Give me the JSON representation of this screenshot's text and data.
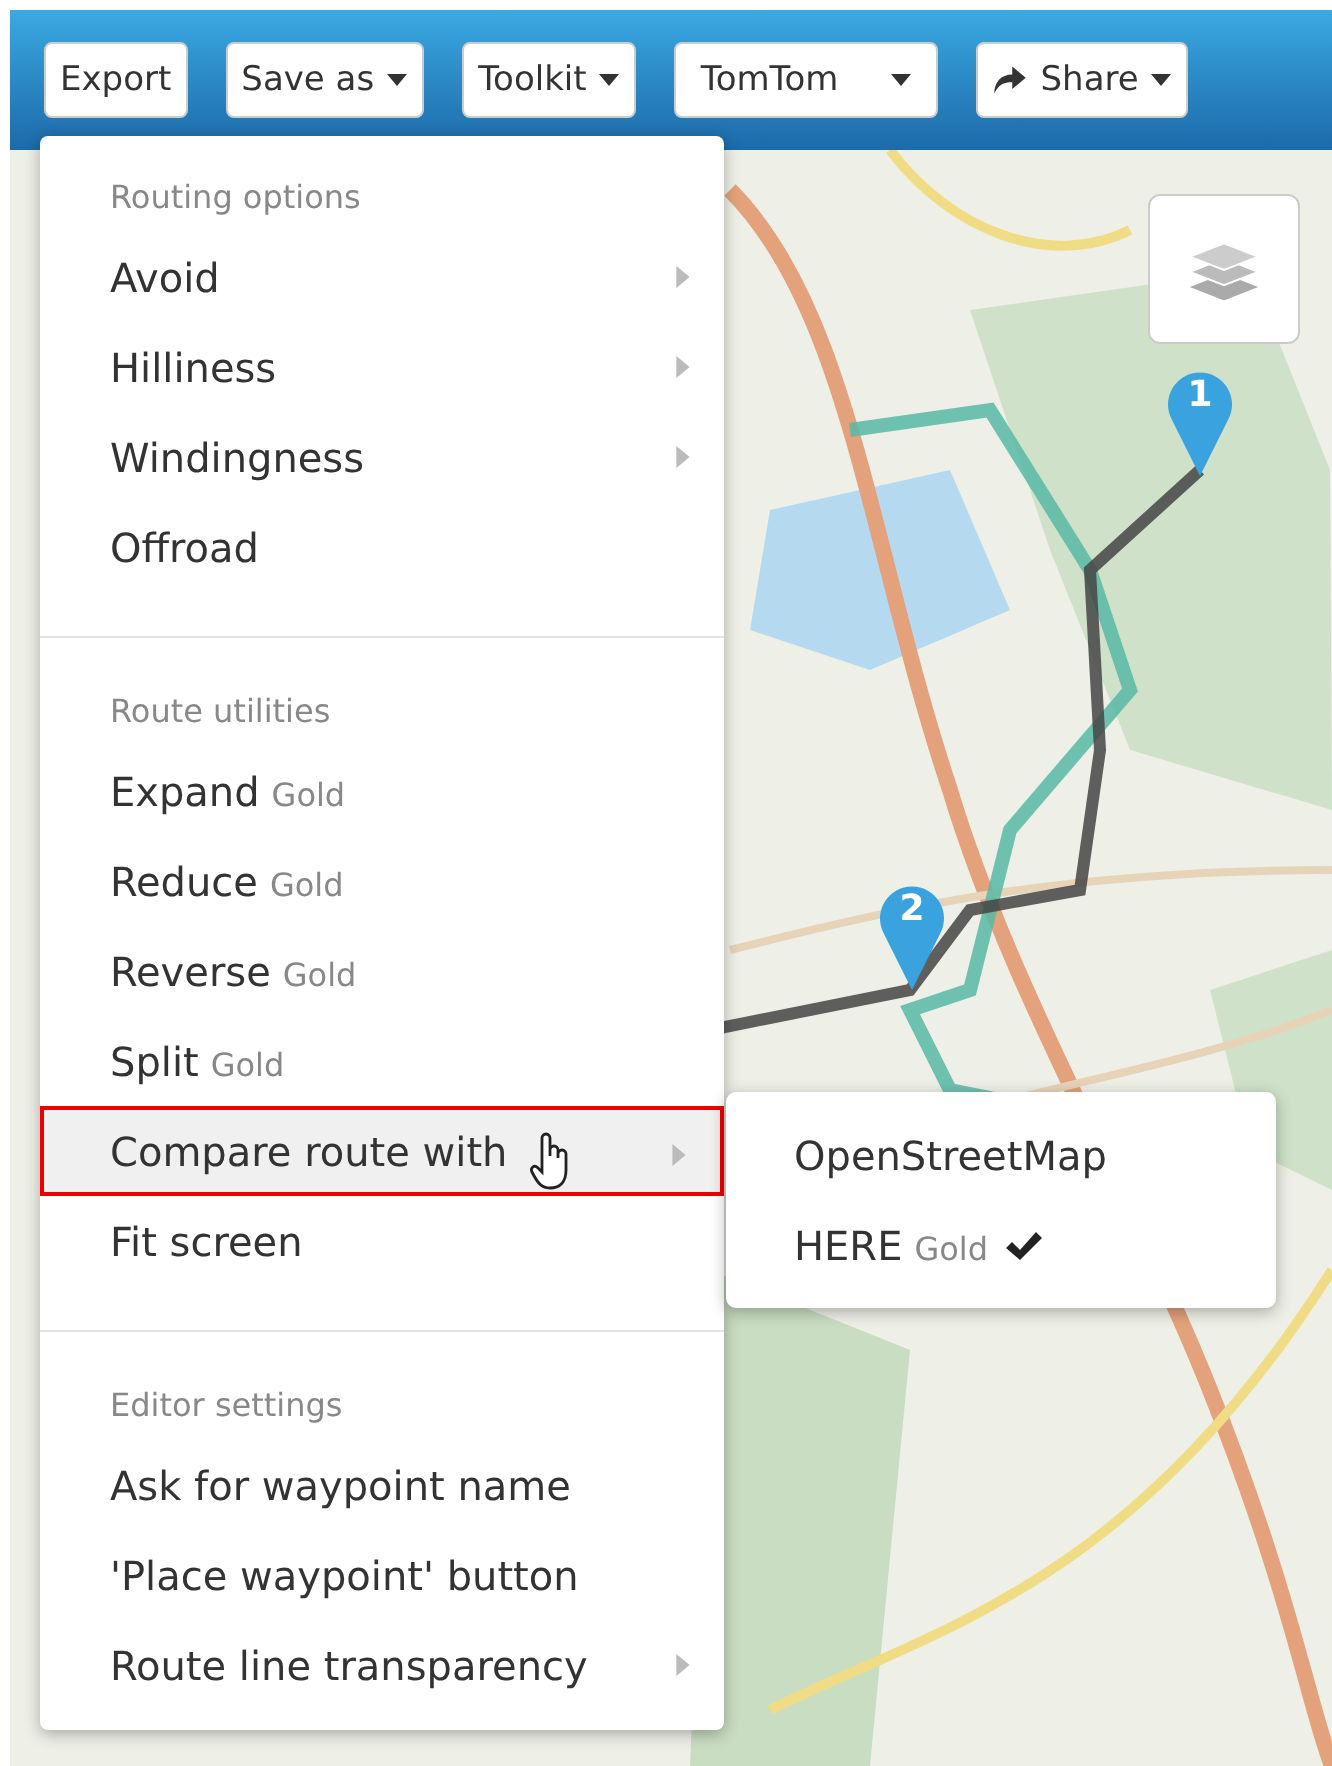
{
  "toolbar": {
    "buttons": [
      {
        "label": "Export",
        "kind": "plain"
      },
      {
        "label": "Save as",
        "kind": "dropdown"
      },
      {
        "label": "Toolkit",
        "kind": "dropdown"
      },
      {
        "label": "TomTom",
        "kind": "select"
      },
      {
        "label": "Share",
        "kind": "share"
      }
    ]
  },
  "waypoints": [
    {
      "label": "1"
    },
    {
      "label": "2"
    }
  ],
  "menu": {
    "sections": [
      {
        "heading": "Routing options",
        "items": [
          {
            "label": "Avoid",
            "submenu": true,
            "highlighted": false
          },
          {
            "label": "Hilliness",
            "submenu": true,
            "highlighted": false
          },
          {
            "label": "Windingness",
            "submenu": true,
            "highlighted": false
          },
          {
            "label": "Offroad",
            "submenu": false,
            "highlighted": false
          }
        ]
      },
      {
        "heading": "Route utilities",
        "items": [
          {
            "label": "Expand",
            "badge": "Gold",
            "submenu": false,
            "highlighted": false
          },
          {
            "label": "Reduce",
            "badge": "Gold",
            "submenu": false,
            "highlighted": false
          },
          {
            "label": "Reverse",
            "badge": "Gold",
            "submenu": false,
            "highlighted": false
          },
          {
            "label": "Split",
            "badge": "Gold",
            "submenu": false,
            "highlighted": false
          },
          {
            "label": "Compare route with",
            "submenu": true,
            "highlighted": true
          },
          {
            "label": "Fit screen",
            "submenu": false,
            "highlighted": false
          }
        ]
      },
      {
        "heading": "Editor settings",
        "items": [
          {
            "label": "Ask for waypoint name",
            "submenu": false,
            "highlighted": false
          },
          {
            "label": "'Place waypoint' button",
            "submenu": false,
            "highlighted": false
          },
          {
            "label": "Route line transparency",
            "submenu": true,
            "highlighted": false
          }
        ]
      }
    ]
  },
  "submenu": {
    "items": [
      {
        "label": "OpenStreetMap",
        "checked": false
      },
      {
        "label": "HERE",
        "badge": "Gold",
        "checked": true
      }
    ]
  }
}
